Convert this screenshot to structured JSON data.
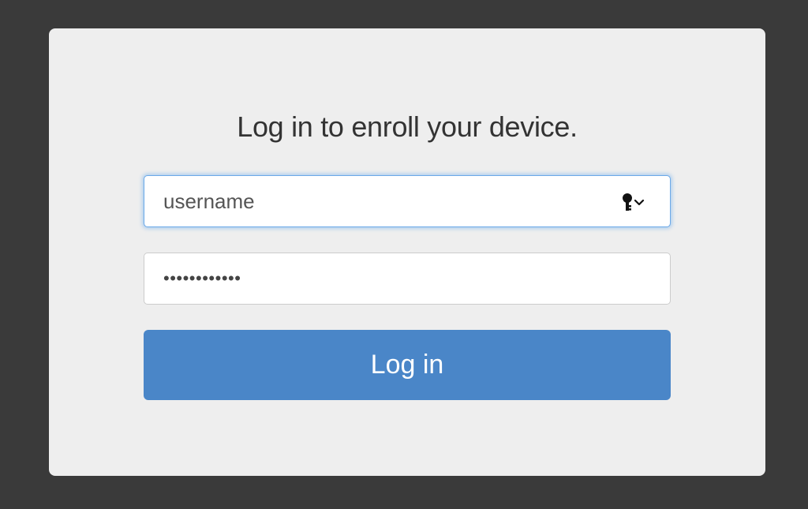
{
  "login_card": {
    "heading": "Log in to enroll your device.",
    "username": {
      "value": "username"
    },
    "password": {
      "masked_value": "••••••••••••"
    },
    "keychain_icon": "key-dropdown-icon",
    "submit_label": "Log in"
  },
  "colors": {
    "page_background": "#3a3a3a",
    "card_background": "#eeeeee",
    "button_background": "#4a86c8",
    "focus_ring": "#6aa8e8"
  }
}
